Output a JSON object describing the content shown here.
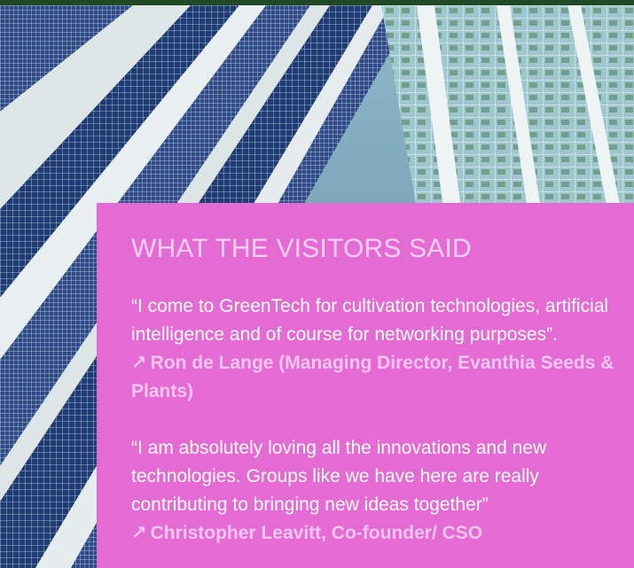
{
  "section": {
    "heading": "WHAT THE VISITORS SAID",
    "testimonials": [
      {
        "quote": "“I come to GreenTech for cultivation technologies, artificial intelligence and of course for networking purposes”.",
        "arrow_icon": "north-east-arrow-icon",
        "attribution": "Ron de Lange (Managing Director, Evanthia Seeds & Plants)"
      },
      {
        "quote": "“I am absolutely loving all the innovations and new technologies. Groups like we have here are really contributing to bringing new ideas together”",
        "arrow_icon": "north-east-arrow-icon",
        "attribution": "Christopher Leavitt, Co-founder/ CSO"
      }
    ]
  },
  "colors": {
    "panel_background": "#e46ad4",
    "heading": "#f9d0f2",
    "quote_text": "#ffffff",
    "attribution": "#f8c6ef",
    "top_bar": "#1f4a25"
  },
  "hero_image": "greenhouse-roof-solar-panels-photo"
}
